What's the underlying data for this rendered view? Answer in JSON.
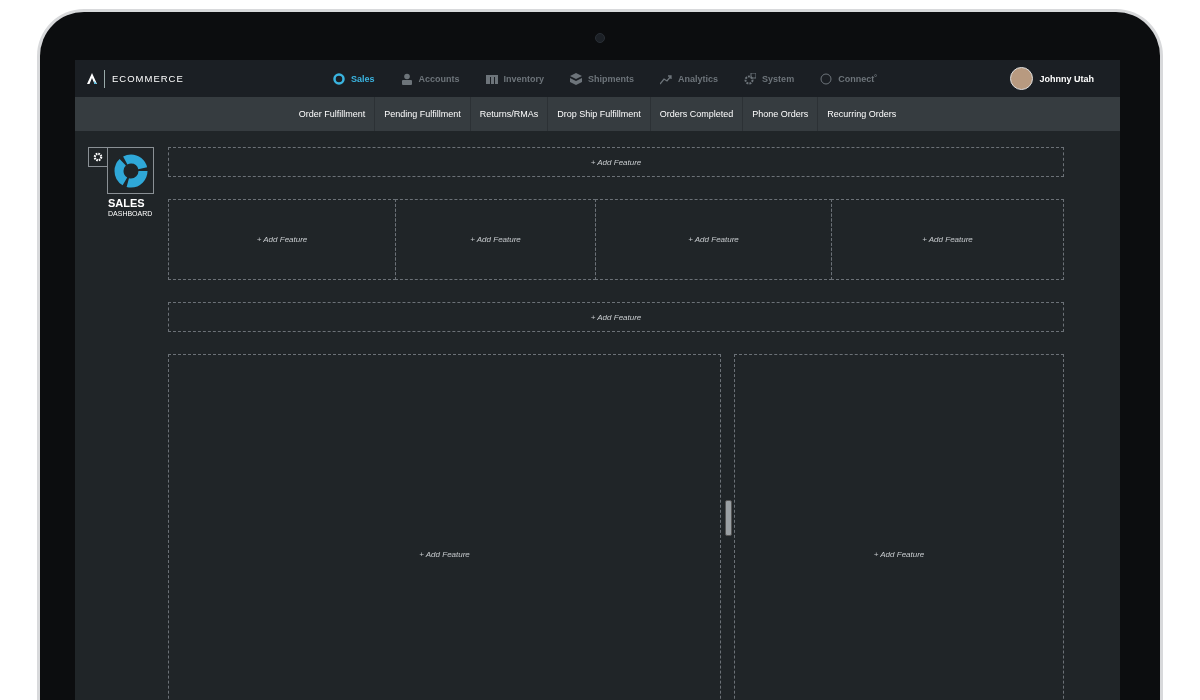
{
  "brand": {
    "name": "ECOMMERCE"
  },
  "nav": [
    {
      "label": "Sales",
      "kind": "sales",
      "selected": true
    },
    {
      "label": "Accounts",
      "kind": "accounts",
      "selected": false
    },
    {
      "label": "Inventory",
      "kind": "inventory",
      "selected": false
    },
    {
      "label": "Shipments",
      "kind": "shipments",
      "selected": false
    },
    {
      "label": "Analytics",
      "kind": "analytics",
      "selected": false
    },
    {
      "label": "System",
      "kind": "system",
      "selected": false
    },
    {
      "label": "Connect˚",
      "kind": "connect",
      "selected": false
    }
  ],
  "user": {
    "name": "Johnny Utah"
  },
  "subnav": [
    {
      "label": "Order Fulfillment"
    },
    {
      "label": "Pending Fulfillment"
    },
    {
      "label": "Returns/RMAs"
    },
    {
      "label": "Drop Ship Fulfillment"
    },
    {
      "label": "Orders Completed"
    },
    {
      "label": "Phone Orders"
    },
    {
      "label": "Recurring Orders"
    }
  ],
  "dashboard": {
    "title": "SALES",
    "subtitle": "DASHBOARD"
  },
  "rows": [
    {
      "kind": "banner",
      "slots": [
        "+ Add Feature"
      ]
    },
    {
      "kind": "quad",
      "slots": [
        "+ Add Feature",
        "+ Add Feature",
        "+ Add Feature",
        "+ Add Feature"
      ]
    },
    {
      "kind": "banner",
      "slots": [
        "+ Add Feature"
      ]
    },
    {
      "kind": "split",
      "slots": [
        "+ Add Feature",
        "+ Add Feature"
      ]
    }
  ]
}
